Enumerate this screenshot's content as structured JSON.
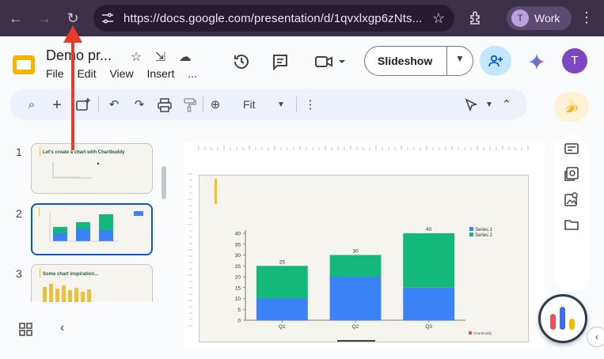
{
  "browser": {
    "url": "https://docs.google.com/presentation/d/1qvxlxgp6zNts...",
    "profile_initial": "T",
    "profile_label": "Work"
  },
  "header": {
    "doc_title": "Demo pr...",
    "menu": [
      "File",
      "Edit",
      "View",
      "Insert",
      "..."
    ],
    "slideshow_label": "Slideshow",
    "user_initial": "T"
  },
  "toolbar": {
    "zoom_label": "Fit"
  },
  "filmstrip": {
    "slides": [
      {
        "number": "1",
        "title": "Let's create a chart with Chartbuddy",
        "selected": false
      },
      {
        "number": "2",
        "title": "",
        "selected": true
      },
      {
        "number": "3",
        "title": "Some chart inspiration...",
        "selected": false
      }
    ]
  },
  "colors": {
    "series1": "#3b82f6",
    "series2": "#14b87a",
    "accent": "#f5c518",
    "selection": "#0b57d0",
    "annotation_arrow": "#ea3a2c"
  },
  "chart_data": {
    "type": "bar",
    "stacked": true,
    "categories": [
      "Q1",
      "Q2",
      "Q3"
    ],
    "series": [
      {
        "name": "Series 1",
        "values": [
          10,
          20,
          15
        ]
      },
      {
        "name": "Series 2",
        "values": [
          15,
          10,
          25
        ]
      }
    ],
    "totals": [
      25,
      30,
      40
    ],
    "ylim": [
      0,
      40
    ],
    "yticks": [
      0,
      5,
      10,
      15,
      20,
      25,
      30,
      35,
      40
    ],
    "legend": "top-right",
    "grid": false,
    "watermark": "Chartbuddy"
  }
}
